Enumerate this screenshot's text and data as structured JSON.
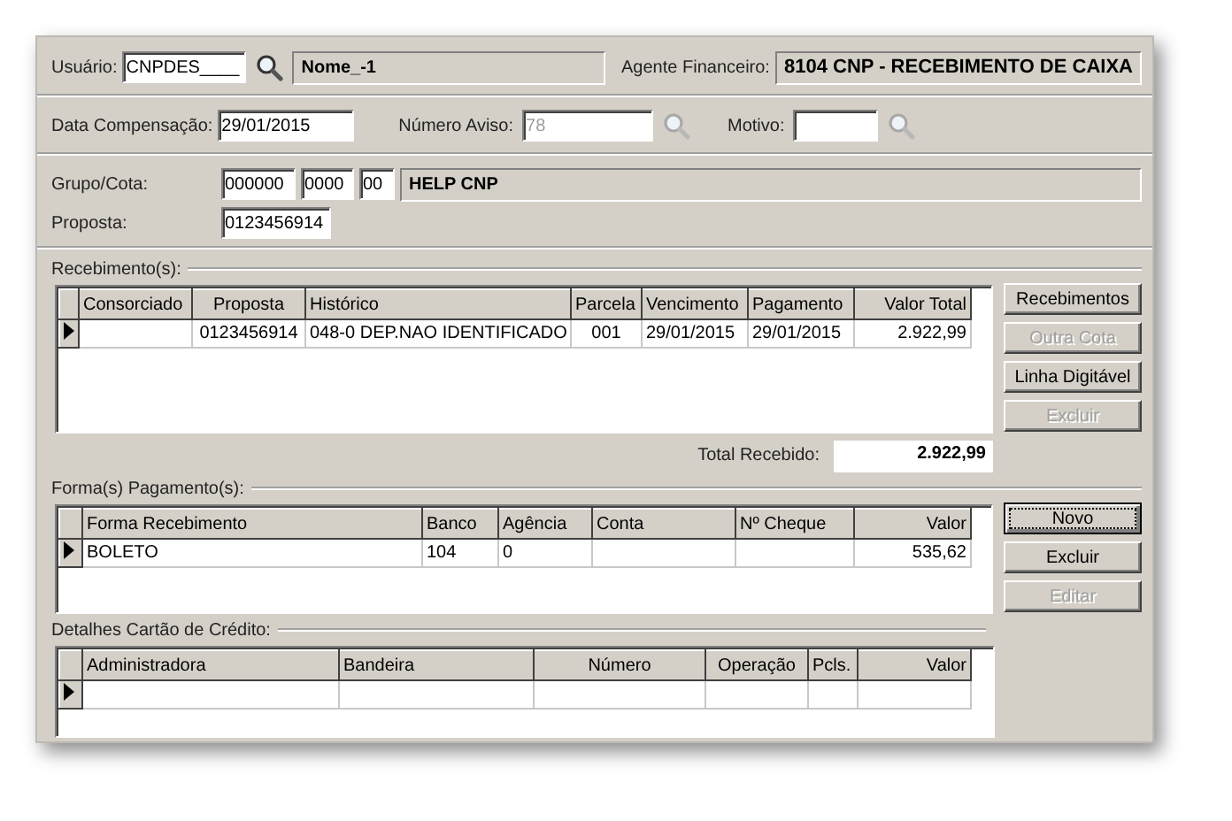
{
  "usuario": {
    "label": "Usuário:",
    "value": "CNPDES____",
    "name": "Nome_-1"
  },
  "agente": {
    "label": "Agente Financeiro:",
    "value": "8104  CNP - RECEBIMENTO DE CAIXA"
  },
  "data_compensacao": {
    "label": "Data Compensação:",
    "value": "29/01/2015"
  },
  "numero_aviso": {
    "label": "Número Aviso:",
    "value": "78",
    "disabled": true
  },
  "motivo": {
    "label": "Motivo:",
    "disabled": true
  },
  "grupo_cota": {
    "label": "Grupo/Cota:",
    "grupo": "000000",
    "cota": "0000",
    "digito": "00",
    "description": "HELP CNP"
  },
  "proposta": {
    "label": "Proposta:",
    "value": "0123456914"
  },
  "recebimentos": {
    "legend": "Recebimento(s):",
    "columns": [
      "Consorciado",
      "Proposta",
      "Histórico",
      "Parcela",
      "Vencimento",
      "Pagamento",
      "Valor Total"
    ],
    "rows": [
      {
        "current": true,
        "cells": [
          "",
          "0123456914",
          "048-0 DEP.NAO IDENTIFICADO",
          "001",
          "29/01/2015",
          "29/01/2015",
          "2.922,99"
        ]
      }
    ]
  },
  "recebimentos_buttons": [
    {
      "label": "Recebimentos",
      "disabled": false
    },
    {
      "label": "Outra Cota",
      "disabled": true
    },
    {
      "label": "Linha Digitável",
      "disabled": false
    },
    {
      "label": "Excluir",
      "disabled": true
    }
  ],
  "total_recebido": {
    "label": "Total Recebido:",
    "value": "2.922,99"
  },
  "pagamentos": {
    "legend": "Forma(s) Pagamento(s):",
    "columns": [
      "Forma Recebimento",
      "Banco",
      "Agência",
      "Conta",
      "Nº Cheque",
      "Valor"
    ],
    "rows": [
      {
        "current": true,
        "cells": [
          "BOLETO",
          "104",
          "0",
          "",
          "",
          "535,62"
        ]
      }
    ]
  },
  "pagamentos_buttons": [
    {
      "label": "Novo",
      "disabled": false,
      "focused": true
    },
    {
      "label": "Excluir",
      "disabled": false,
      "focused": false
    },
    {
      "label": "Editar",
      "disabled": true,
      "focused": false
    }
  ],
  "cartao": {
    "legend": "Detalhes Cartão de Crédito:",
    "columns": [
      "Administradora",
      "Bandeira",
      "Número",
      "Operação",
      "Pcls.",
      "Valor"
    ],
    "rows": [
      {
        "current": true
      }
    ]
  }
}
